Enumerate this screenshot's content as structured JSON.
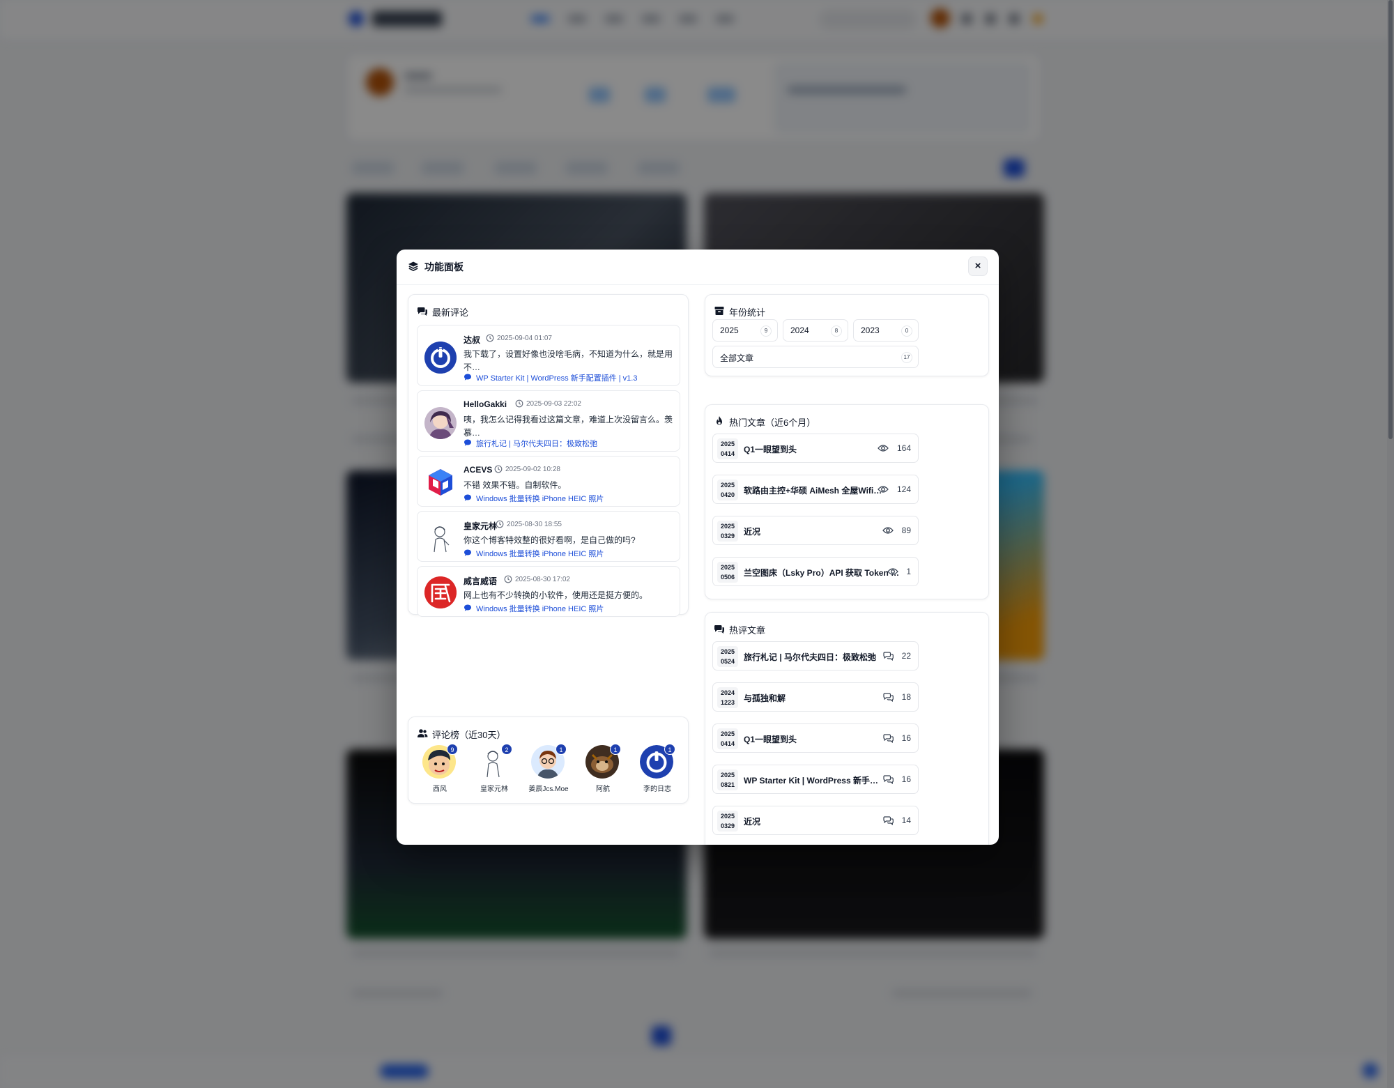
{
  "modal": {
    "title": "功能面板",
    "close_label": "×"
  },
  "latest_comments": {
    "title": "最新评论",
    "items": [
      {
        "name": "达叔",
        "time": "2025-09-04 01:07",
        "text": "我下载了，设置好像也没啥毛病，不知道为什么，就是用不…",
        "post": "WP Starter Kit | WordPress 新手配置插件 | v1.3",
        "avatar": "power-icon-avatar"
      },
      {
        "name": "HelloGakki",
        "time": "2025-09-03 22:02",
        "text": "咦，我怎么记得我看过这篇文章，难道上次没留言么。羡慕…",
        "post": "旅行札记 | 马尔代夫四日：极致松弛",
        "avatar": "anime-avatar"
      },
      {
        "name": "ACEVS",
        "time": "2025-09-02 10:28",
        "text": "不错 效果不错。自制软件。",
        "post": "Windows 批量转换 iPhone HEIC 照片",
        "avatar": "cube-logo-avatar"
      },
      {
        "name": "皇家元林",
        "time": "2025-08-30 18:55",
        "text": "你这个博客特效整的很好看啊，是自己做的吗?",
        "post": "Windows 批量转换 iPhone HEIC 照片",
        "avatar": "sketch-avatar"
      },
      {
        "name": "威言威语",
        "time": "2025-08-30 17:02",
        "text": "网上也有不少转换的小软件，使用还是挺方便的。",
        "post": "Windows 批量转换 iPhone HEIC 照片",
        "avatar": "wei-character-avatar"
      }
    ]
  },
  "leaderboard": {
    "title": "评论榜（近30天）",
    "items": [
      {
        "name": "西风",
        "count": "9"
      },
      {
        "name": "皇家元林",
        "count": "2"
      },
      {
        "name": "姜辰Jcs.Moe",
        "count": "1"
      },
      {
        "name": "阿航",
        "count": "1"
      },
      {
        "name": "李的日志",
        "count": "1"
      }
    ]
  },
  "year_stats": {
    "title": "年份统计",
    "years": [
      {
        "label": "2025",
        "count": "9"
      },
      {
        "label": "2024",
        "count": "8"
      },
      {
        "label": "2023",
        "count": "0"
      }
    ],
    "all_label": "全部文章",
    "all_count": "17"
  },
  "hot_articles": {
    "title": "热门文章（近6个月）",
    "items": [
      {
        "year": "2025",
        "md": "0414",
        "title": "Q1一眼望到头",
        "views": "164"
      },
      {
        "year": "2025",
        "md": "0420",
        "title": "软路由主控+华硕 AiMesh 全屋Wifi升级",
        "views": "124"
      },
      {
        "year": "2025",
        "md": "0329",
        "title": "近况",
        "views": "89"
      },
      {
        "year": "2025",
        "md": "0506",
        "title": "兰空图床（Lsky Pro）API 获取 Token 教程",
        "views": "1"
      }
    ]
  },
  "hot_commented": {
    "title": "热评文章",
    "items": [
      {
        "year": "2025",
        "md": "0524",
        "title": "旅行札记 | 马尔代夫四日：极致松弛",
        "comments": "22"
      },
      {
        "year": "2024",
        "md": "1223",
        "title": "与孤独和解",
        "comments": "18"
      },
      {
        "year": "2025",
        "md": "0414",
        "title": "Q1一眼望到头",
        "comments": "16"
      },
      {
        "year": "2025",
        "md": "0821",
        "title": "WP Starter Kit | WordPress 新手配置插件 |…",
        "comments": "16"
      },
      {
        "year": "2025",
        "md": "0329",
        "title": "近况",
        "comments": "14"
      }
    ]
  },
  "colors": {
    "accent": "#1d4ed8",
    "badge": "#1e40af",
    "overlay": "rgba(0,0,0,0.46)"
  }
}
